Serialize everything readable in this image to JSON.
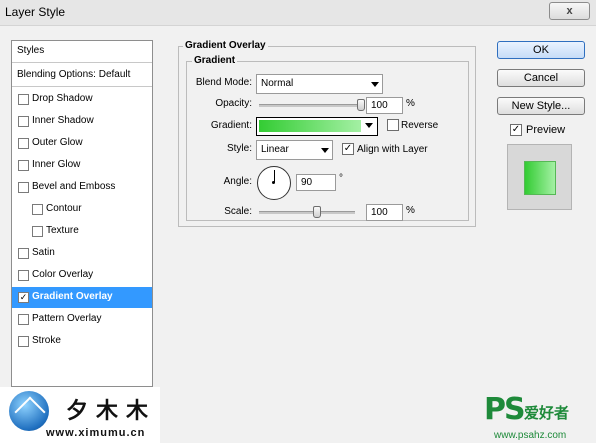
{
  "window": {
    "title": "Layer Style",
    "close_glyph": "x"
  },
  "styles_panel": {
    "header": "Styles",
    "blending": "Blending Options: Default",
    "items": [
      {
        "label": "Drop Shadow",
        "checked": false
      },
      {
        "label": "Inner Shadow",
        "checked": false
      },
      {
        "label": "Outer Glow",
        "checked": false
      },
      {
        "label": "Inner Glow",
        "checked": false
      },
      {
        "label": "Bevel and Emboss",
        "checked": false
      },
      {
        "label": "Contour",
        "checked": false
      },
      {
        "label": "Texture",
        "checked": false
      },
      {
        "label": "Satin",
        "checked": false
      },
      {
        "label": "Color Overlay",
        "checked": false
      },
      {
        "label": "Gradient Overlay",
        "checked": true
      },
      {
        "label": "Pattern Overlay",
        "checked": false
      },
      {
        "label": "Stroke",
        "checked": false
      }
    ]
  },
  "gradient_overlay": {
    "title": "Gradient Overlay",
    "group_title": "Gradient",
    "blend_mode_label": "Blend Mode:",
    "blend_mode_value": "Normal",
    "opacity_label": "Opacity:",
    "opacity_value": "100",
    "opacity_unit": "%",
    "opacity_level": 1.0,
    "gradient_label": "Gradient:",
    "gradient_colors": [
      "#33cc33",
      "#a4f0a4"
    ],
    "reverse_label": "Reverse",
    "reverse_checked": false,
    "style_label": "Style:",
    "style_value": "Linear",
    "align_label": "Align with Layer",
    "align_checked": true,
    "angle_label": "Angle:",
    "angle_value": "90",
    "angle_unit": "°",
    "scale_label": "Scale:",
    "scale_value": "100",
    "scale_unit": "%",
    "scale_level": 0.6
  },
  "buttons": {
    "ok": "OK",
    "cancel": "Cancel",
    "new_style": "New Style..."
  },
  "preview": {
    "label": "Preview",
    "checked": true,
    "check_glyph": "✓"
  },
  "watermark_left": {
    "text": "夕木木",
    "url": "www.ximumu.cn"
  },
  "watermark_right": {
    "logo": "PS",
    "text": "爱好者",
    "url": "www.psahz.com"
  },
  "colors": {
    "selection": "#3399ff",
    "accent_green": "#33cc33",
    "panel_bg": "#f1f1f1"
  }
}
